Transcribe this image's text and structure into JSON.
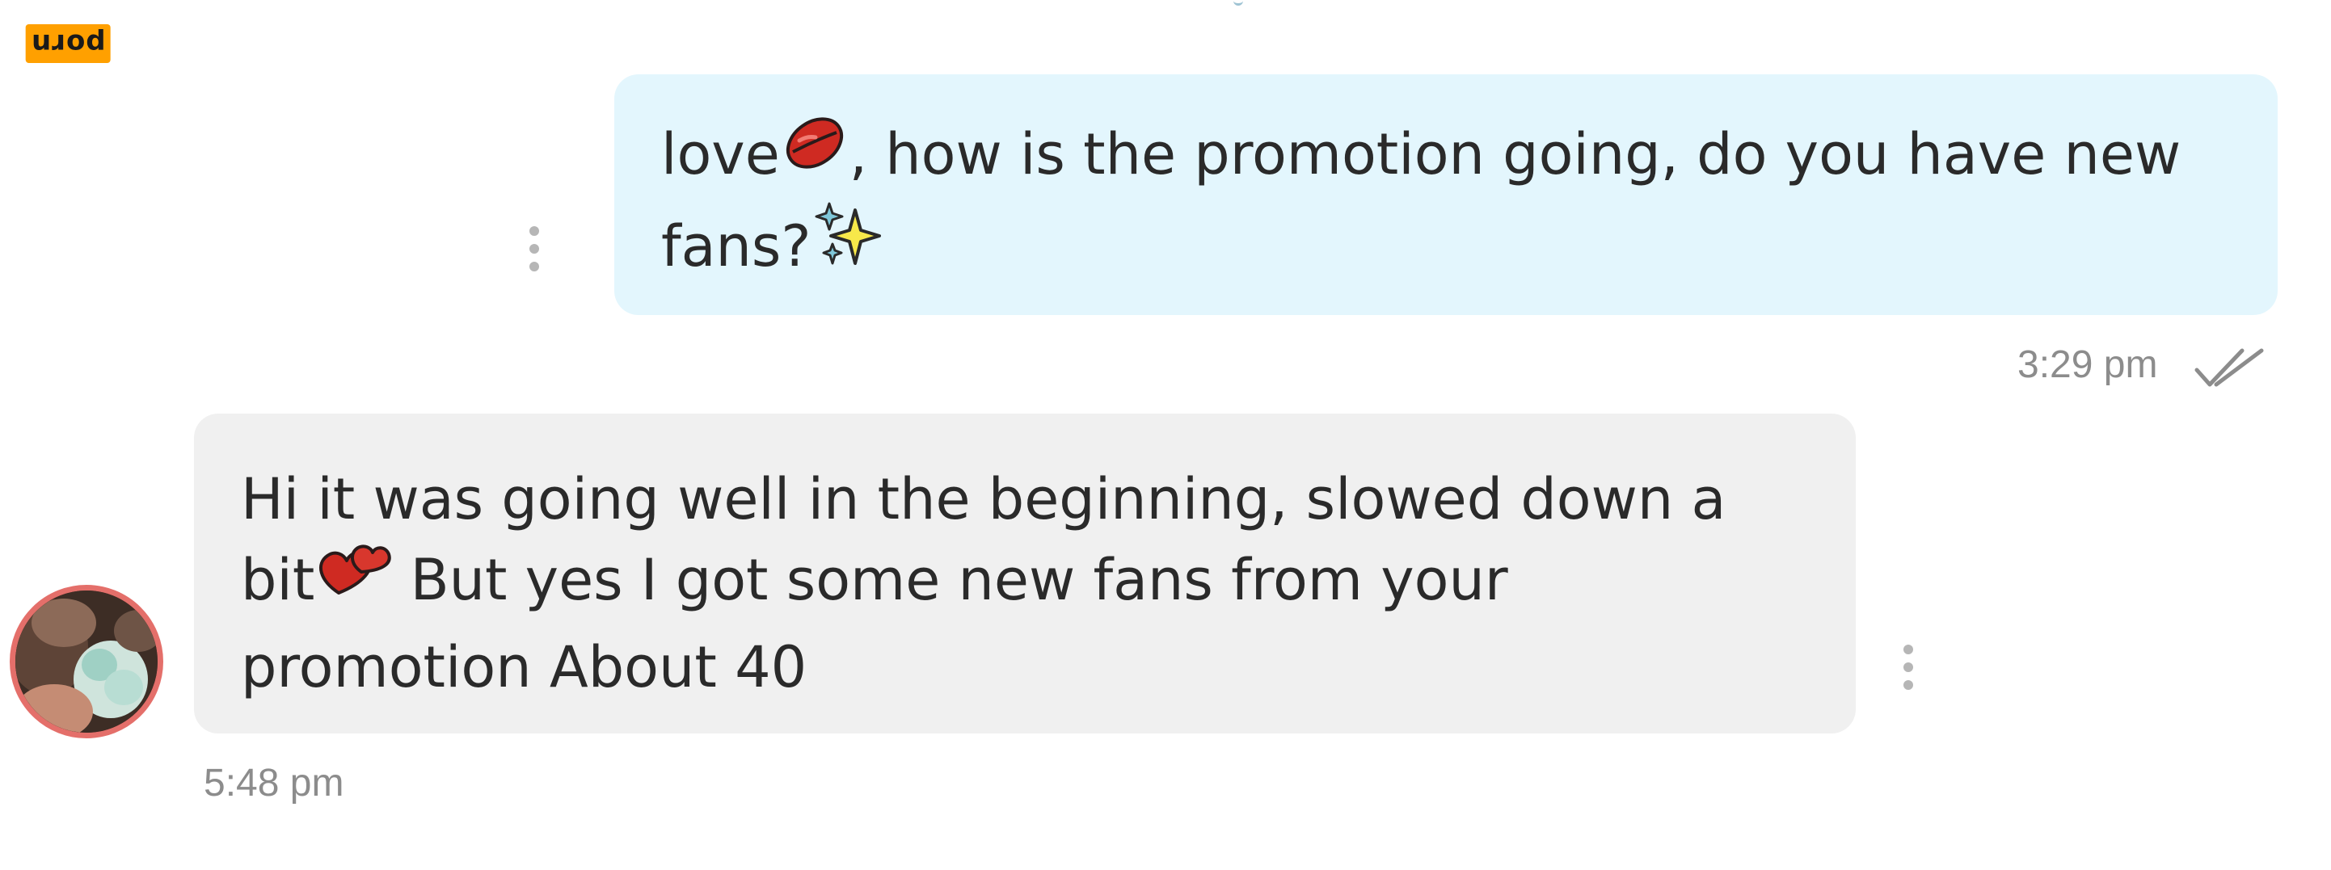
{
  "badge": {
    "text": "porn"
  },
  "conversation": {
    "messages": [
      {
        "direction": "sent",
        "lines": [
          {
            "before": "love",
            "emoji": "kiss-lips-emoji",
            "after": ", how is the promotion going, do you have new"
          },
          {
            "before": "fans?",
            "emoji": "sparkles-emoji",
            "after": ""
          }
        ],
        "time": "3:29 pm",
        "status_icon": "double-check-icon"
      },
      {
        "direction": "received",
        "lines": [
          {
            "before": "Hi it was going well in the beginning, slowed down a",
            "emoji": "",
            "after": ""
          },
          {
            "before": "bit",
            "emoji": "two-hearts-emoji",
            "after": " But yes I got some new fans from your"
          },
          {
            "before": "promotion About 40",
            "emoji": "",
            "after": ""
          }
        ],
        "time": "5:48 pm",
        "avatar": "sender-avatar"
      }
    ]
  },
  "colors": {
    "sent_bubble": "#e3f6fd",
    "received_bubble": "#f0f0f0",
    "avatar_ring": "#e46f6a",
    "badge": "#ffa000",
    "timestamp": "#8c8c8c"
  }
}
